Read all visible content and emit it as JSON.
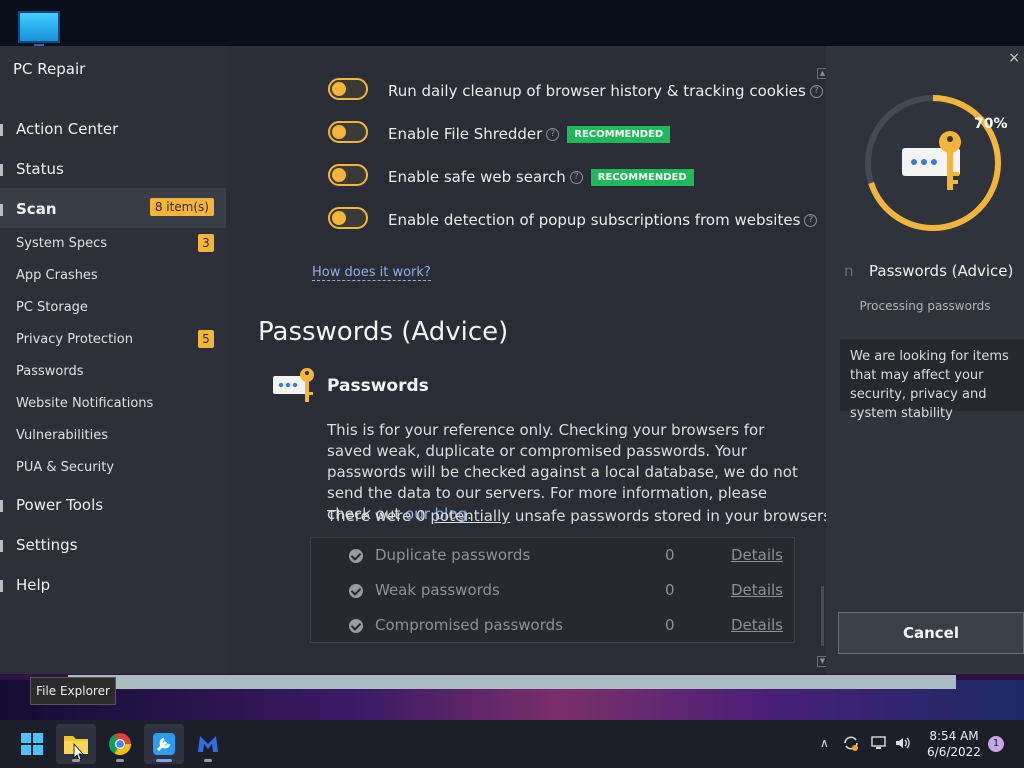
{
  "app": {
    "title": "PC Repair"
  },
  "sidebar": {
    "main_items": [
      {
        "label": "Action Center"
      },
      {
        "label": "Status"
      },
      {
        "label": "Scan",
        "badge": "8 item(s)"
      },
      {
        "label": "Power Tools"
      },
      {
        "label": "Settings"
      },
      {
        "label": "Help"
      }
    ],
    "sub_items": [
      {
        "label": "System Specs",
        "badge": "3"
      },
      {
        "label": "App Crashes"
      },
      {
        "label": "PC Storage"
      },
      {
        "label": "Privacy Protection",
        "badge": "5"
      },
      {
        "label": "Passwords"
      },
      {
        "label": "Website Notifications"
      },
      {
        "label": "Vulnerabilities"
      },
      {
        "label": "PUA & Security"
      }
    ]
  },
  "main": {
    "toggles": [
      {
        "label": "Run daily cleanup of browser history & tracking cookies",
        "enabled": true
      },
      {
        "label": "Enable File Shredder",
        "recommended": "RECOMMENDED",
        "enabled": true
      },
      {
        "label": "Enable safe web search",
        "recommended": "RECOMMENDED",
        "enabled": true
      },
      {
        "label": "Enable detection of popup subscriptions from websites",
        "enabled": true
      }
    ],
    "help_glyph": "?",
    "how_link": "How does it work?",
    "section_title": "Passwords (Advice)",
    "pw_heading": "Passwords",
    "pw_desc": "This is for your reference only. Checking your browsers for saved weak, duplicate or compromised passwords. Your passwords will be checked against a local database, we do not send the data to our servers. For more information, please check out ",
    "pw_link": "our blog",
    "pw_desc_end": ".",
    "pw_count_pre": "There were 0 ",
    "pw_count_u": "potentially",
    "pw_count_post": " unsafe passwords stored in your browsers.",
    "pw_rows": [
      {
        "label": "Duplicate passwords",
        "count": "0",
        "details": "Details"
      },
      {
        "label": "Weak passwords",
        "count": "0",
        "details": "Details"
      },
      {
        "label": "Compromised passwords",
        "count": "0",
        "details": "Details"
      }
    ]
  },
  "right_panel": {
    "progress": 0.7,
    "percent_label": "70%",
    "n_fragment": "n",
    "title": "Passwords (Advice)",
    "status": "Processing passwords",
    "info": "We are looking for items that may affect your security, privacy and system stability",
    "cancel": "Cancel",
    "close_glyph": "×"
  },
  "tooltip": "File Explorer",
  "taskbar": {
    "time": "8:54 AM",
    "date": "6/6/2022",
    "notifications": "1",
    "chevron": "∧"
  },
  "colors": {
    "accent": "#f4b53a",
    "recommended": "#1fb85a",
    "link": "#8fb0e8"
  }
}
